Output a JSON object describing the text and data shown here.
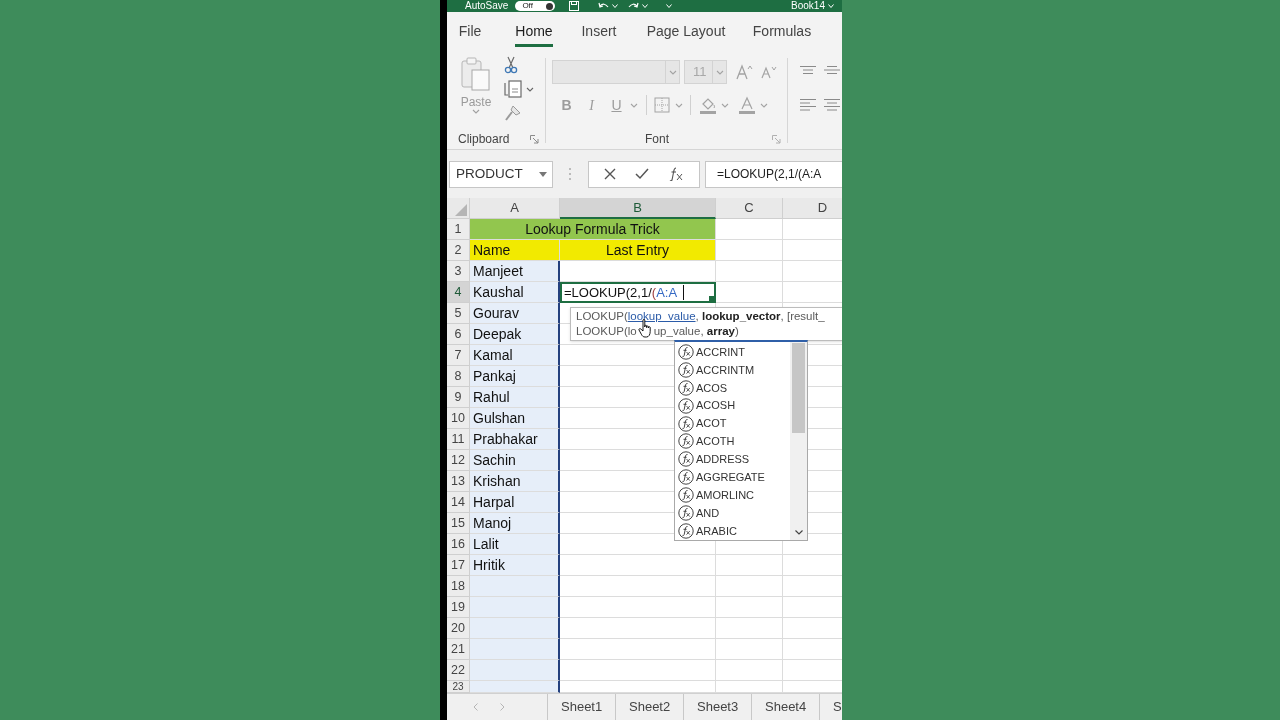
{
  "title_bar": {
    "autosave_label": "AutoSave",
    "autosave_toggle": {
      "label": "Off",
      "on": false
    },
    "document_title": "Book14"
  },
  "ribbon_tabs": [
    {
      "label": "File",
      "selected": false
    },
    {
      "label": "Home",
      "selected": true
    },
    {
      "label": "Insert",
      "selected": false
    },
    {
      "label": "Page Layout",
      "selected": false
    },
    {
      "label": "Formulas",
      "selected": false
    }
  ],
  "ribbon": {
    "clipboard": {
      "paste_label": "Paste",
      "group_label": "Clipboard"
    },
    "font": {
      "font_size": "11",
      "disabled": true,
      "format_buttons": [
        {
          "label": "B",
          "kind": "bold"
        },
        {
          "label": "I",
          "kind": "italic"
        },
        {
          "label": "U",
          "kind": "underline"
        }
      ],
      "group_label": "Font"
    }
  },
  "formula_bar": {
    "name_box": "PRODUCT",
    "formula": "=LOOKUP(2,1/(A:A"
  },
  "columns": [
    {
      "label": "A",
      "selected": false,
      "referenced": true
    },
    {
      "label": "B",
      "selected": true,
      "referenced": false
    },
    {
      "label": "C",
      "selected": false,
      "referenced": false
    },
    {
      "label": "D",
      "selected": false,
      "referenced": false
    }
  ],
  "rows": [
    {
      "number": "1",
      "selected": false,
      "cells": [
        {
          "kind": "title",
          "text": "Lookup Formula Trick"
        }
      ]
    },
    {
      "number": "2",
      "selected": false,
      "cells": [
        {
          "kind": "header",
          "text": "Name",
          "centered": false
        },
        {
          "kind": "header",
          "text": "Last Entry",
          "centered": true
        }
      ]
    },
    {
      "number": "3",
      "selected": false,
      "cells": [
        {
          "kind": "name",
          "text": "Manjeet"
        }
      ]
    },
    {
      "number": "4",
      "selected": true,
      "cells": [
        {
          "kind": "name",
          "text": "Kaushal"
        },
        {
          "kind": "editing",
          "parts": [
            {
              "kind": "plain",
              "text": "=LOOKUP(2,1/"
            },
            {
              "kind": "paren",
              "text": "("
            },
            {
              "kind": "reference",
              "text": "A:A"
            }
          ]
        }
      ]
    },
    {
      "number": "5",
      "selected": false,
      "cells": [
        {
          "kind": "name",
          "text": "Gourav"
        }
      ]
    },
    {
      "number": "6",
      "selected": false,
      "cells": [
        {
          "kind": "name",
          "text": "Deepak"
        }
      ]
    },
    {
      "number": "7",
      "selected": false,
      "cells": [
        {
          "kind": "name",
          "text": "Kamal"
        }
      ]
    },
    {
      "number": "8",
      "selected": false,
      "cells": [
        {
          "kind": "name",
          "text": "Pankaj"
        }
      ]
    },
    {
      "number": "9",
      "selected": false,
      "cells": [
        {
          "kind": "name",
          "text": "Rahul"
        }
      ]
    },
    {
      "number": "10",
      "selected": false,
      "cells": [
        {
          "kind": "name",
          "text": "Gulshan"
        }
      ]
    },
    {
      "number": "11",
      "selected": false,
      "cells": [
        {
          "kind": "name",
          "text": "Prabhakar"
        }
      ]
    },
    {
      "number": "12",
      "selected": false,
      "cells": [
        {
          "kind": "name",
          "text": "Sachin"
        }
      ]
    },
    {
      "number": "13",
      "selected": false,
      "cells": [
        {
          "kind": "name",
          "text": "Krishan"
        }
      ]
    },
    {
      "number": "14",
      "selected": false,
      "cells": [
        {
          "kind": "name",
          "text": "Harpal"
        }
      ]
    },
    {
      "number": "15",
      "selected": false,
      "cells": [
        {
          "kind": "name",
          "text": "Manoj"
        }
      ]
    },
    {
      "number": "16",
      "selected": false,
      "cells": [
        {
          "kind": "name",
          "text": "Lalit"
        }
      ]
    },
    {
      "number": "17",
      "selected": false,
      "cells": [
        {
          "kind": "name",
          "text": "Hritik"
        }
      ]
    },
    {
      "number": "18",
      "selected": false
    },
    {
      "number": "19",
      "selected": false
    },
    {
      "number": "20",
      "selected": false
    },
    {
      "number": "21",
      "selected": false
    },
    {
      "number": "22",
      "selected": false
    },
    {
      "number": "23",
      "selected": false
    }
  ],
  "tooltip": {
    "lines": [
      {
        "parts": [
          {
            "kind": "text",
            "text": "LOOKUP("
          },
          {
            "kind": "link",
            "text": "lookup_value"
          },
          {
            "kind": "text",
            "text": ", **lookup_vector**, [result_"
          }
        ]
      },
      {
        "parts": [
          {
            "kind": "text",
            "text": "LOOKUP(lo"
          },
          {
            "kind": "pointer"
          },
          {
            "kind": "text",
            "text": "up_value, **array**)"
          }
        ]
      }
    ]
  },
  "autocomplete": {
    "items": [
      {
        "label": "ACCRINT",
        "selected": false
      },
      {
        "label": "ACCRINTM",
        "selected": false
      },
      {
        "label": "ACOS",
        "selected": false
      },
      {
        "label": "ACOSH",
        "selected": false
      },
      {
        "label": "ACOT",
        "selected": false
      },
      {
        "label": "ACOTH",
        "selected": false
      },
      {
        "label": "ADDRESS",
        "selected": false
      },
      {
        "label": "AGGREGATE",
        "selected": false
      },
      {
        "label": "AMORLINC",
        "selected": false
      },
      {
        "label": "AND",
        "selected": false
      },
      {
        "label": "ARABIC",
        "selected": false
      }
    ]
  },
  "sheet_tabs": [
    {
      "label": "Sheet1",
      "selected": false
    },
    {
      "label": "Sheet2",
      "selected": false
    },
    {
      "label": "Sheet3",
      "selected": false
    },
    {
      "label": "Sheet4",
      "selected": false
    },
    {
      "label": "S",
      "selected": false
    }
  ]
}
